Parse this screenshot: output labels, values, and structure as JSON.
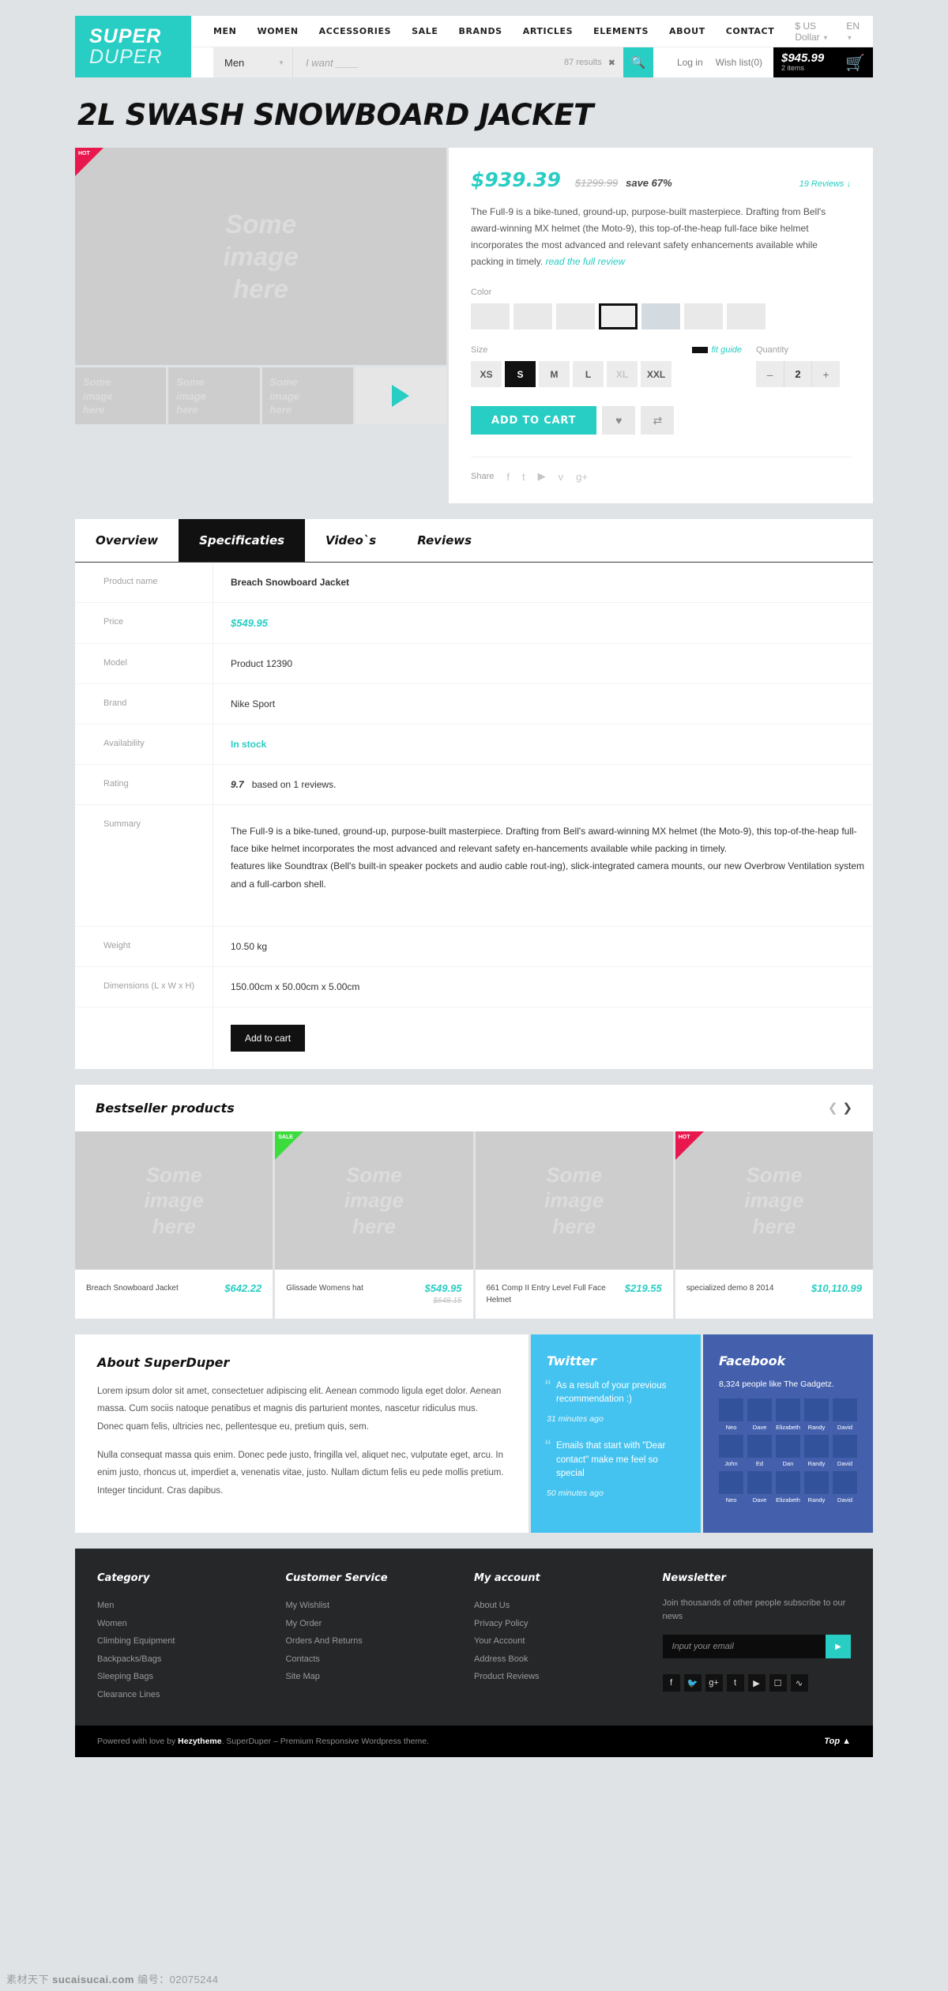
{
  "header": {
    "logo_top": "SUPER",
    "logo_bottom": "DUPER",
    "nav": [
      {
        "label": "MEN"
      },
      {
        "label": "WOMEN"
      },
      {
        "label": "ACCESSORIES"
      },
      {
        "label": "SALE"
      },
      {
        "label": "BRANDS"
      },
      {
        "label": "ARTICLES"
      },
      {
        "label": "ELEMENTS"
      },
      {
        "label": "ABOUT"
      },
      {
        "label": "CONTACT"
      }
    ],
    "currency": "$ US Dollar",
    "language": "EN",
    "search": {
      "category": "Men",
      "placeholder": "I want ____",
      "results": "87 results",
      "clear_icon": "close-icon",
      "search_icon": "search-icon"
    },
    "login": "Log in",
    "wishlist": "Wish list(0)",
    "cart": {
      "total": "$945.99",
      "items": "2 items",
      "icon": "cart-icon"
    }
  },
  "product": {
    "title": "2L SWASH SNOWBOARD JACKET",
    "badge": "HOT",
    "gallery": {
      "main_placeholder": "Some\nimage\nhere",
      "thumbs": [
        "Some image here",
        "Some image here",
        "Some image here"
      ],
      "play_icon": "play-icon"
    },
    "price_now": "$939.39",
    "price_old": "$1299.99",
    "save": "save 67%",
    "reviews_link": "19 Reviews ↓",
    "description": "The Full-9 is a bike-tuned, ground-up, purpose-built masterpiece. Drafting from Bell's award-winning MX helmet (the Moto-9), this top-of-the-heap full-face bike helmet incorporates the most advanced and relevant safety enhancements available while packing in timely.",
    "read_more": "read the full review",
    "color_label": "Color",
    "size_label": "Size",
    "fit_guide": "fit guide",
    "quantity_label": "Quantity",
    "sizes": [
      "XS",
      "S",
      "M",
      "L",
      "XL",
      "XXL"
    ],
    "size_selected": "S",
    "size_disabled": "XL",
    "quantity": "2",
    "qty_minus": "–",
    "qty_plus": "+",
    "add_to_cart": "ADD TO CART",
    "wishlist_icon": "heart-icon",
    "compare_icon": "compare-icon",
    "share_label": "Share",
    "share_icons": [
      "facebook-icon",
      "twitter-icon",
      "youtube-icon",
      "vimeo-icon",
      "googleplus-icon"
    ]
  },
  "tabs": [
    {
      "label": "Overview",
      "active": false
    },
    {
      "label": "Specificaties",
      "active": true
    },
    {
      "label": "Video`s",
      "active": false
    },
    {
      "label": "Reviews",
      "active": false
    }
  ],
  "specs": {
    "rows": [
      {
        "key": "Product name",
        "value": "Breach Snowboard Jacket",
        "style": "bold"
      },
      {
        "key": "Price",
        "value": "$549.95",
        "style": "teal"
      },
      {
        "key": "Model",
        "value": "Product 12390",
        "style": "plain"
      },
      {
        "key": "Brand",
        "value": "Nike Sport",
        "style": "plain"
      },
      {
        "key": "Availability",
        "value": "In stock",
        "style": "stock"
      },
      {
        "key": "Rating",
        "value": "9.7",
        "suffix": "based on 1 reviews.",
        "style": "rating"
      },
      {
        "key": "Summary",
        "value": "The Full-9 is a bike-tuned, ground-up, purpose-built masterpiece. Drafting from Bell's award-winning MX helmet (the Moto-9), this top-of-the-heap full-face bike helmet incorporates the most advanced and relevant safety en-hancements available while packing in timely.\n features like Soundtrax (Bell's built-in speaker pockets and audio cable rout-ing), slick-integrated camera mounts, our new Overbrow Ventilation system and a full-carbon shell.",
        "style": "para"
      },
      {
        "key": "Weight",
        "value": "10.50 kg",
        "style": "plain"
      },
      {
        "key": "Dimensions (L x W x H)",
        "value": "150.00cm x 50.00cm x 5.00cm",
        "style": "plain"
      }
    ],
    "add_to_cart": "Add to cart"
  },
  "bestseller": {
    "title": "Bestseller products",
    "prev_icon": "chevron-left-icon",
    "next_icon": "chevron-right-icon",
    "cards": [
      {
        "placeholder": "Some image here",
        "badge": "",
        "name": "Breach Snowboard Jacket",
        "price": "$642.22",
        "old_price": ""
      },
      {
        "placeholder": "Some image here",
        "badge": "SALE",
        "name": "Glissade Womens hat",
        "price": "$549.95",
        "old_price": "$648.15"
      },
      {
        "placeholder": "Some image here",
        "badge": "",
        "name": "661 Comp II Entry Level Full Face Helmet",
        "price": "$219.55",
        "old_price": ""
      },
      {
        "placeholder": "Some image here",
        "badge": "HOT",
        "name": "specialized demo 8 2014",
        "price": "$10,110.99",
        "old_price": ""
      }
    ]
  },
  "about": {
    "title": "About SuperDuper",
    "p1": "Lorem ipsum dolor sit amet, consectetuer adipiscing elit. Aenean commodo ligula eget dolor. Aenean massa. Cum sociis natoque penatibus et magnis dis parturient montes, nascetur ridiculus mus. Donec quam felis, ultricies nec, pellentesque eu, pretium quis, sem.",
    "p2": "Nulla consequat massa quis enim. Donec pede justo, fringilla vel, aliquet nec, vulputate eget, arcu. In enim justo, rhoncus ut, imperdiet a, venenatis vitae, justo. Nullam dictum felis eu pede mollis pretium. Integer tincidunt. Cras dapibus."
  },
  "twitter": {
    "title": "Twitter",
    "tweets": [
      {
        "text": "As a result of your previous recommendation :)",
        "ago": "31 minutes ago"
      },
      {
        "text": "Emails that start with \"Dear contact\" make me feel so special",
        "ago": "50 minutes ago"
      }
    ]
  },
  "facebook": {
    "title": "Facebook",
    "count": "8,324 people like The Gadgetz.",
    "faces": [
      "Neo",
      "Dave",
      "Elizabeth",
      "Randy",
      "David",
      "John",
      "Ed",
      "Dan",
      "Randy",
      "David",
      "Neo",
      "Dave",
      "Elizabeth",
      "Randy",
      "David"
    ]
  },
  "footer": {
    "columns": [
      {
        "title": "Category",
        "links": [
          "Men",
          "Women",
          "Climbing Equipment",
          "Backpacks/Bags",
          "Sleeping Bags",
          "Clearance Lines"
        ]
      },
      {
        "title": "Customer Service",
        "links": [
          "My Wishlist",
          "My Order",
          "Orders And Returns",
          "Contacts",
          "Site Map"
        ]
      },
      {
        "title": "My account",
        "links": [
          "About Us",
          "Privacy Policy",
          "Your Account",
          "Address Book",
          "Product Reviews"
        ]
      }
    ],
    "newsletter": {
      "title": "Newsletter",
      "text": "Join thousands of other people subscribe to our news",
      "placeholder": "Input your email",
      "submit_icon": "play-icon"
    },
    "social": [
      "facebook-icon",
      "twitter-icon",
      "googleplus-icon",
      "tumblr-icon",
      "youtube-icon",
      "instagram-icon",
      "rss-icon"
    ],
    "bottom_prefix": "Powered with love by ",
    "bottom_brand": "Hezytheme",
    "bottom_suffix": ". SuperDuper – Premium Responsive Wordpress theme.",
    "top_label": "Top ▲"
  },
  "watermark": {
    "cn": "素材天下",
    "site": "sucaisucai.com",
    "no_label": "编号：",
    "no": "02075244"
  },
  "colors": {
    "accent": "#28cdc3",
    "dark": "#111111",
    "hot": "#e8184f",
    "sale": "#3ddc3d",
    "twitter": "#45c3f0",
    "facebook": "#4460ad"
  }
}
